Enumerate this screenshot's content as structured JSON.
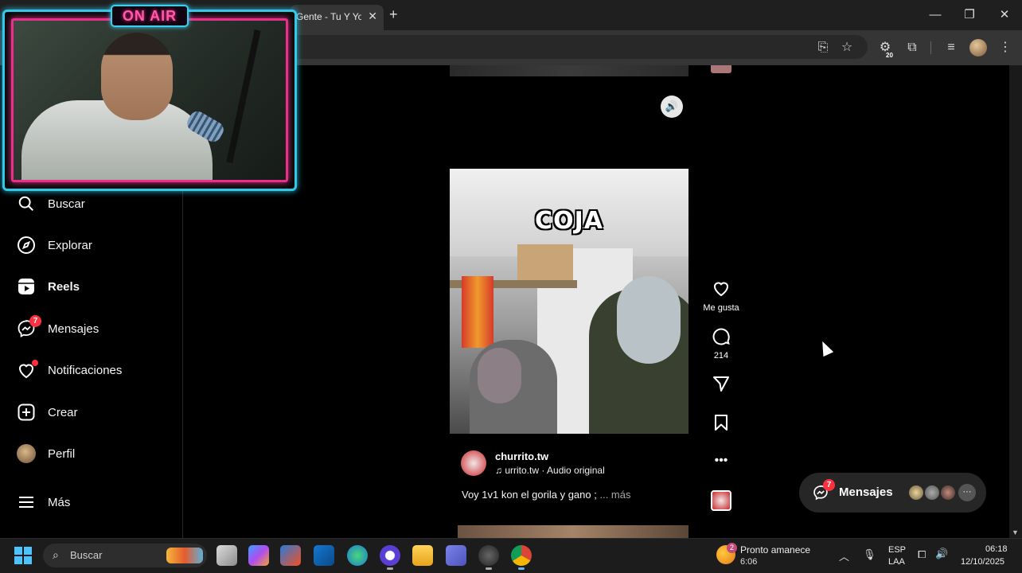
{
  "browser": {
    "tab_title": "Gente - Tu Y Yo",
    "tab_close": "✕",
    "new_tab": "+",
    "window_controls": {
      "minimize": "—",
      "maximize": "❐",
      "close": "✕"
    },
    "extension_badge": "20"
  },
  "stream_overlay": {
    "on_air_label": "ON AIR"
  },
  "sidebar": {
    "items": [
      {
        "label": "Buscar",
        "icon": "search-icon"
      },
      {
        "label": "Explorar",
        "icon": "compass-icon"
      },
      {
        "label": "Reels",
        "icon": "reels-icon",
        "active": true
      },
      {
        "label": "Mensajes",
        "icon": "messenger-icon",
        "badge": "7"
      },
      {
        "label": "Notificaciones",
        "icon": "heart-icon",
        "dot": true
      },
      {
        "label": "Crear",
        "icon": "plus-square-icon"
      },
      {
        "label": "Perfil",
        "icon": "avatar"
      },
      {
        "label": "Más",
        "icon": "menu-icon"
      }
    ]
  },
  "reel": {
    "overlay_text": "COJA",
    "author": "churrito.tw",
    "audio": "urrito.tw · Audio original",
    "caption": "Voy 1v1 kon el gorila y gano ;",
    "caption_more": "... más",
    "actions": {
      "like_label": "Me gusta",
      "comments_count": "214"
    }
  },
  "messages_pill": {
    "label": "Mensajes",
    "badge": "7",
    "more": "···"
  },
  "taskbar": {
    "search_label": "Buscar",
    "weather_title": "Pronto amanece",
    "weather_sub": "6:06",
    "weather_badge": "2",
    "lang_top": "ESP",
    "lang_bottom": "LAA",
    "time": "06:18",
    "date": "12/10/2025"
  },
  "colors": {
    "accent_red": "#ff3040",
    "onair_cyan": "#34c8e8",
    "onair_pink": "#e8308a"
  }
}
